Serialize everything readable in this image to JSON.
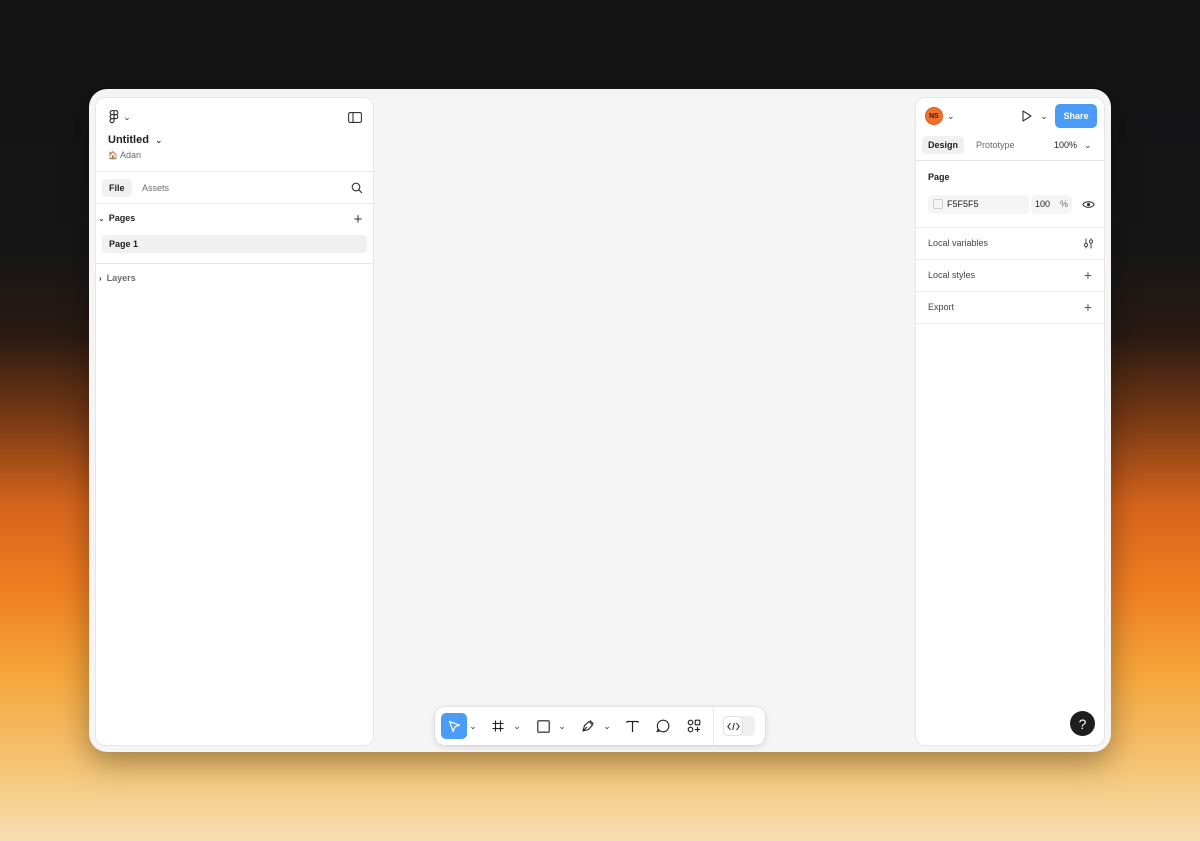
{
  "file": {
    "name": "Untitled",
    "team": "Adan",
    "team_icon": "🏠"
  },
  "left_tabs": {
    "file": "File",
    "assets": "Assets"
  },
  "pages": {
    "header": "Pages",
    "items": [
      {
        "label": "Page 1"
      }
    ]
  },
  "layers": {
    "header": "Layers"
  },
  "header_right": {
    "avatar": "NS",
    "avatar_color": "#f2702b",
    "share_label": "Share",
    "share_color": "#4a9cf6"
  },
  "right_tabs": {
    "design": "Design",
    "prototype": "Prototype",
    "zoom": "100%"
  },
  "page_section": {
    "title": "Page",
    "color_hex": "F5F5F5",
    "opacity": "100",
    "opacity_unit": "%"
  },
  "sections": {
    "local_variables": "Local variables",
    "local_styles": "Local styles",
    "export": "Export"
  },
  "help": {
    "label": "?"
  },
  "toolbar": {
    "active_color": "#4a9cf6",
    "tools": [
      "move-tool",
      "frame-tool",
      "shape-tool",
      "pen-tool",
      "text-tool",
      "comment-tool",
      "actions-tool",
      "dev-mode-toggle"
    ]
  }
}
